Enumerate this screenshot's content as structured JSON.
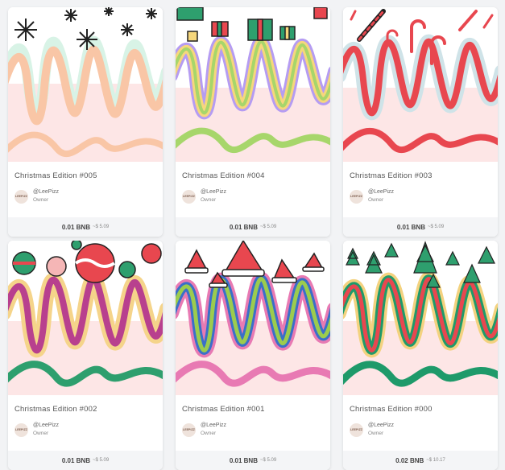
{
  "cards": [
    {
      "title": "Christmas Edition #005",
      "creator_handle": "@LeePizz",
      "creator_role": "Owner",
      "avatar_text": "LEEPIZZ",
      "price_bnb": "0.01 BNB",
      "price_usd": "~$ 5.09",
      "theme": "snowflakes",
      "colors": [
        "#f9c6a6",
        "#d8f3e6",
        "#fde2cf"
      ]
    },
    {
      "title": "Christmas Edition #004",
      "creator_handle": "@LeePizz",
      "creator_role": "Owner",
      "avatar_text": "LEEPIZZ",
      "price_bnb": "0.01 BNB",
      "price_usd": "~$ 5.09",
      "theme": "gifts",
      "colors": [
        "#b59cf2",
        "#f6d77c",
        "#a7d66b"
      ]
    },
    {
      "title": "Christmas Edition #003",
      "creator_handle": "@LeePizz",
      "creator_role": "Owner",
      "avatar_text": "LEEPIZZ",
      "price_bnb": "0.01 BNB",
      "price_usd": "~$ 5.09",
      "theme": "candy-canes",
      "colors": [
        "#cfe3e8",
        "#f2a9a9",
        "#e8474f"
      ]
    },
    {
      "title": "Christmas Edition #002",
      "creator_handle": "@LeePizz",
      "creator_role": "Owner",
      "avatar_text": "LEEPIZZ",
      "price_bnb": "0.01 BNB",
      "price_usd": "~$ 5.09",
      "theme": "ornaments",
      "colors": [
        "#b8408e",
        "#2e9f6e",
        "#f5d48a"
      ]
    },
    {
      "title": "Christmas Edition #001",
      "creator_handle": "@LeePizz",
      "creator_role": "Owner",
      "avatar_text": "LEEPIZZ",
      "price_bnb": "0.01 BNB",
      "price_usd": "~$ 5.09",
      "theme": "santa-hats",
      "colors": [
        "#e87ab3",
        "#3a6fc9",
        "#9ccc4e"
      ]
    },
    {
      "title": "Christmas Edition #000",
      "creator_handle": "@LeePizz",
      "creator_role": "Owner",
      "avatar_text": "LEEPIZZ",
      "price_bnb": "0.02 BNB",
      "price_usd": "~$ 10.17",
      "theme": "trees",
      "colors": [
        "#f3d27f",
        "#1e9a6a",
        "#e8474f"
      ]
    }
  ],
  "icons": {
    "snowflake": "snowflake-icon",
    "gift": "gift-icon",
    "candy": "candy-cane-icon",
    "ornament": "ornament-icon",
    "hat": "santa-hat-icon",
    "tree": "christmas-tree-icon"
  }
}
